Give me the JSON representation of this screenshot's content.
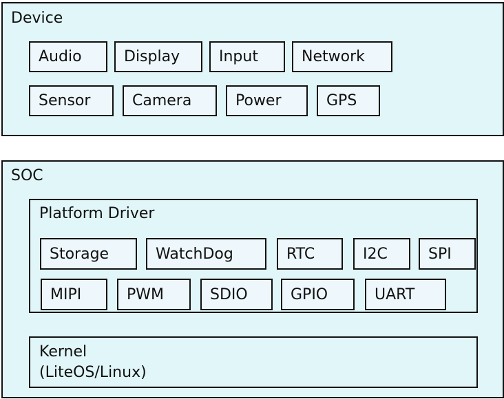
{
  "device": {
    "title": "Device",
    "items": [
      "Audio",
      "Display",
      "Input",
      "Network",
      "Sensor",
      "Camera",
      "Power",
      "GPS"
    ]
  },
  "soc": {
    "title": "SOC",
    "platform_driver": {
      "title": "Platform Driver",
      "items": [
        "Storage",
        "WatchDog",
        "RTC",
        "I2C",
        "SPI",
        "MIPI",
        "PWM",
        "SDIO",
        "GPIO",
        "UART"
      ]
    },
    "kernel": {
      "line1": "Kernel",
      "line2": "(LiteOS/Linux)"
    }
  }
}
